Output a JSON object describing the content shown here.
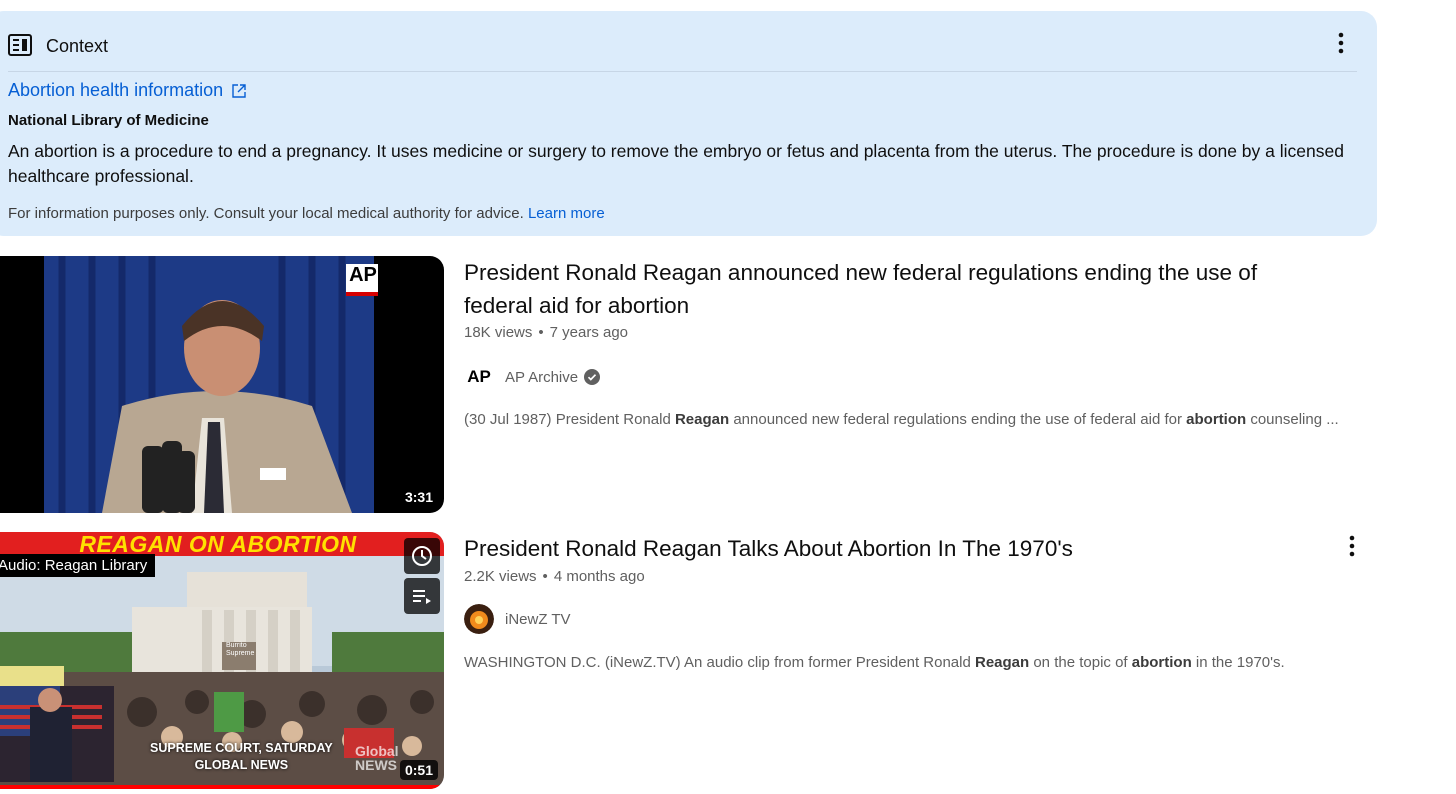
{
  "context": {
    "header_title": "Context",
    "link_text": "Abortion health information",
    "source": "National Library of Medicine",
    "body": "An abortion is a procedure to end a pregnancy. It uses medicine or surgery to remove the embryo or fetus and placenta from the uterus. The procedure is done by a licensed healthcare professional.",
    "disclaimer": "For information purposes only. Consult your local medical authority for advice.",
    "learn_more": "Learn more"
  },
  "videos": [
    {
      "title": "President Ronald Reagan announced new federal regulations ending the use of federal aid for abortion",
      "views": "18K views",
      "age": "7 years ago",
      "channel": "AP Archive",
      "verified": true,
      "desc_parts": [
        "(30 Jul 1987) President Ronald ",
        "Reagan",
        " announced new federal regulations ending the use of federal aid for ",
        "abortion",
        " counseling ..."
      ],
      "duration": "3:31",
      "thumb_badge": "AP",
      "avatar_text": "AP"
    },
    {
      "title": "President Ronald Reagan Talks About Abortion In The 1970's",
      "views": "2.2K views",
      "age": "4 months ago",
      "channel": "iNewZ TV",
      "verified": false,
      "desc_parts": [
        "WASHINGTON D.C. (iNewZ.TV) An audio clip from former President Ronald ",
        "Reagan",
        " on the topic of ",
        "abortion",
        " in the 1970's."
      ],
      "duration": "0:51",
      "banner": "REAGAN ON ABORTION",
      "audio_label": "Audio: Reagan Library",
      "caption_line1": "SUPREME COURT, SATURDAY",
      "caption_line2": "GLOBAL NEWS",
      "watermark": "Global NEWS",
      "sign_text": "Burrito Supreme"
    }
  ],
  "colors": {
    "panel_bg": "#dcecfb",
    "link": "#065fd4",
    "progress": "#ff0000"
  }
}
